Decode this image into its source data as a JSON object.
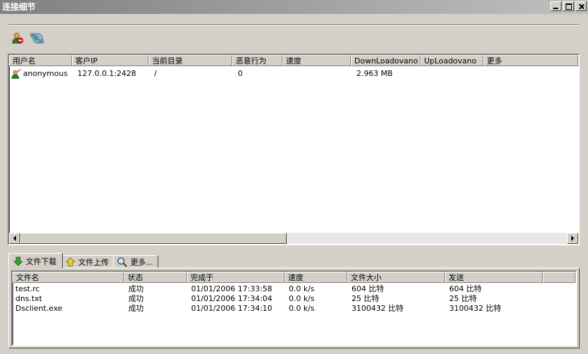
{
  "window": {
    "title": "连接细节"
  },
  "toolbar": {
    "icons": [
      "disconnect-user-icon",
      "network-computers-icon"
    ]
  },
  "connections": {
    "columns": [
      "用户名",
      "客户IP",
      "当前目录",
      "恶意行为",
      "速度",
      "DownLoadovano",
      "UpLoadovano",
      "更多"
    ],
    "rows": [
      {
        "user": "anonymous",
        "ip": "127.0.0.1:2428",
        "dir": "/",
        "malicious": "0",
        "speed": "",
        "download": "2.963 MB",
        "upload": "",
        "more": ""
      }
    ]
  },
  "tabs": [
    {
      "label": "文件下载",
      "icon": "download-arrow-icon",
      "active": true
    },
    {
      "label": "文件上传",
      "icon": "upload-arrow-icon",
      "active": false
    },
    {
      "label": "更多...",
      "icon": "magnifier-icon",
      "active": false
    }
  ],
  "files": {
    "columns": [
      "文件名",
      "状态",
      "完成于",
      "速度",
      "文件大小",
      "发送"
    ],
    "rows": [
      {
        "name": "test.rc",
        "status": "成功",
        "completed": "01/01/2006  17:33:58",
        "speed": "0.0 k/s",
        "size": "604 比特",
        "sent": "604 比特"
      },
      {
        "name": "dns.txt",
        "status": "成功",
        "completed": "01/01/2006  17:34:04",
        "speed": "0.0 k/s",
        "size": "25 比特",
        "sent": "25 比特"
      },
      {
        "name": "Dsclient.exe",
        "status": "成功",
        "completed": "01/01/2006  17:34:10",
        "speed": "0.0 k/s",
        "size": "3100432 比特",
        "sent": "3100432 比特"
      }
    ]
  }
}
